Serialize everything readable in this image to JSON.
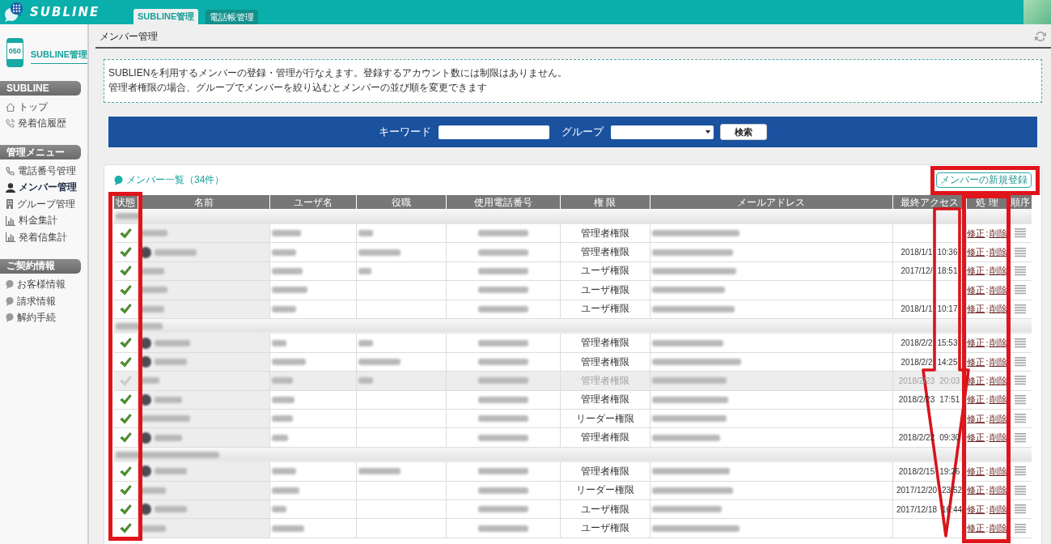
{
  "header": {
    "logo_text": "SUBLINE",
    "tabs": [
      {
        "label": "SUBLINE管理",
        "selected": true
      },
      {
        "label": "電話帳管理",
        "selected": false
      }
    ]
  },
  "sidebar": {
    "badge": "050",
    "title": "SUBLINE管理",
    "sections": [
      {
        "heading": "SUBLINE",
        "items": [
          {
            "label": "トップ",
            "kind": "home",
            "selected": false
          },
          {
            "label": "発着信履歴",
            "kind": "call",
            "selected": false
          }
        ]
      },
      {
        "heading": "管理メニュー",
        "items": [
          {
            "label": "電話番号管理",
            "kind": "phone",
            "selected": false
          },
          {
            "label": "メンバー管理",
            "kind": "user",
            "selected": true
          },
          {
            "label": "グループ管理",
            "kind": "building",
            "selected": false
          },
          {
            "label": "料金集計",
            "kind": "chart",
            "selected": false
          },
          {
            "label": "発着信集計",
            "kind": "chart",
            "selected": false
          }
        ]
      },
      {
        "heading": "ご契約情報",
        "items": [
          {
            "label": "お客様情報",
            "kind": "bubble",
            "selected": false
          },
          {
            "label": "請求情報",
            "kind": "bubble",
            "selected": false
          },
          {
            "label": "解約手続",
            "kind": "bubble",
            "selected": false
          }
        ]
      }
    ]
  },
  "page": {
    "title": "メンバー管理",
    "notice": [
      "SUBLIENを利用するメンバーの登録・管理が行なえます。登録するアカウント数には制限はありません。",
      "管理者権限の場合、グループでメンバーを絞り込むとメンバーの並び順を変更できます"
    ]
  },
  "search": {
    "keyword_label": "キーワード",
    "group_label": "グループ",
    "button": "検索"
  },
  "members": {
    "title": "メンバー一覧（34件）",
    "new_button": "メンバーの新規登録",
    "columns": [
      "状態",
      "名前",
      "ユーザ名",
      "役職",
      "使用電話番号",
      "権 限",
      "メールアドレス",
      "最終アクセス",
      "処 理",
      "順序"
    ],
    "groups": [
      {
        "rows": [
          {
            "active": true,
            "avatar": false,
            "has_title": true,
            "role": "管理者権限",
            "edit": "修正",
            "separator": ":",
            "delete": "削除"
          },
          {
            "active": true,
            "avatar": true,
            "has_title": true,
            "role": "管理者権限",
            "access_date": "2018/1/1",
            "access_time": "10:36",
            "edit": "修正",
            "separator": ":",
            "delete": "削除"
          },
          {
            "active": true,
            "avatar": false,
            "has_title": true,
            "role": "ユーザ権限",
            "access_date": "2017/12/",
            "access_time": "18:51",
            "edit": "修正",
            "separator": ":",
            "delete": "削除"
          },
          {
            "active": true,
            "avatar": false,
            "has_title": false,
            "role": "ユーザ権限",
            "edit": "修正",
            "separator": ":",
            "delete": "削除"
          },
          {
            "active": true,
            "avatar": false,
            "has_title": false,
            "role": "ユーザ権限",
            "access_date": "2018/1/1",
            "access_time": "10:17",
            "edit": "修正",
            "separator": ":",
            "delete": "削除"
          }
        ]
      },
      {
        "rows": [
          {
            "active": true,
            "avatar": true,
            "has_title": true,
            "role": "管理者権限",
            "access_date": "2018/2/2",
            "access_time": "15:53",
            "edit": "修正",
            "separator": ":",
            "delete": "削除"
          },
          {
            "active": true,
            "avatar": true,
            "has_title": true,
            "role": "管理者権限",
            "access_date": "2018/2/2",
            "access_time": "14:25",
            "edit": "修正",
            "separator": ":",
            "delete": "削除"
          },
          {
            "active": false,
            "avatar": false,
            "has_title": true,
            "role": "管理者権限",
            "access_date": "2018/2/23",
            "access_time": "20:03",
            "edit": "修正",
            "separator": ":",
            "delete": "削除"
          },
          {
            "active": true,
            "avatar": true,
            "has_title": false,
            "role": "管理者権限",
            "access_date": "2018/2/23",
            "access_time": "17:51",
            "edit": "修正",
            "separator": ":",
            "delete": "削除"
          },
          {
            "active": true,
            "avatar": false,
            "has_title": false,
            "role": "リーダー権限",
            "edit": "修正",
            "separator": ":",
            "delete": "削除"
          },
          {
            "active": true,
            "avatar": true,
            "has_title": false,
            "role": "管理者権限",
            "access_date": "2018/2/22",
            "access_time": "09:30",
            "edit": "修正",
            "separator": ":",
            "delete": "削除"
          }
        ]
      },
      {
        "rows": [
          {
            "active": true,
            "avatar": true,
            "has_title": true,
            "role": "管理者権限",
            "access_date": "2018/2/15",
            "access_time": "19:26",
            "edit": "修正",
            "separator": ":",
            "delete": "削除"
          },
          {
            "active": true,
            "avatar": false,
            "has_title": false,
            "role": "リーダー権限",
            "access_date": "2017/12/20",
            "access_time": "23:52",
            "edit": "修正",
            "separator": ":",
            "delete": "削除"
          },
          {
            "active": true,
            "avatar": true,
            "has_title": false,
            "role": "ユーザ権限",
            "access_date": "2017/12/18",
            "access_time": "16:44",
            "edit": "修正",
            "separator": ":",
            "delete": "削除"
          },
          {
            "active": true,
            "avatar": false,
            "has_title": false,
            "role": "ユーザ権限",
            "edit": "修正",
            "separator": ":",
            "delete": "削除"
          }
        ]
      }
    ]
  },
  "annotations": [
    {
      "kind": "frame"
    },
    {
      "kind": "frame"
    },
    {
      "kind": "frame"
    },
    {
      "kind": "arrow"
    }
  ]
}
